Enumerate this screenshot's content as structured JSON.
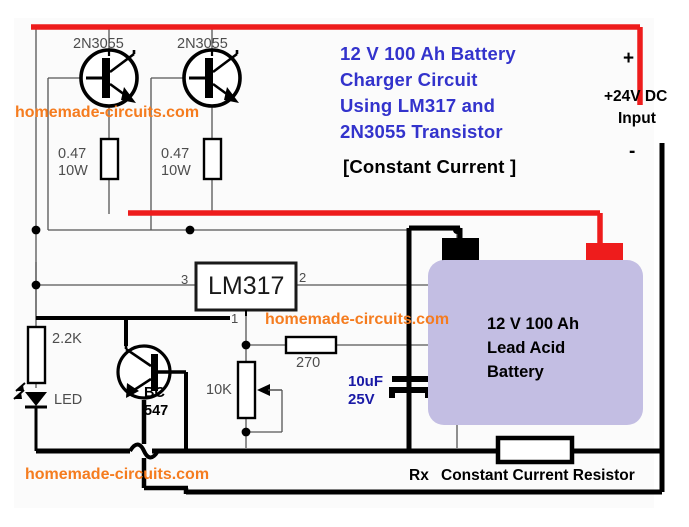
{
  "diagram": {
    "title_lines": [
      "12 V 100 Ah Battery",
      "Charger Circuit",
      "Using LM317 and",
      "2N3055  Transistor"
    ],
    "subtitle": "[Constant Current ]",
    "colors": {
      "title": "#3333cc",
      "subtitle": "#000000",
      "positive_rail": "#ee1c1c",
      "negative_rail": "#000000",
      "battery_body": "#c3bee3",
      "watermark": "#f57c1f",
      "thin_wire": "#555555"
    }
  },
  "supply": {
    "plus_sign": "+",
    "minus_sign": "-",
    "label_line1": "+24V DC",
    "label_line2": "Input"
  },
  "components": {
    "q1": {
      "name": "2N3055"
    },
    "q2": {
      "name": "2N3055"
    },
    "r_emitter1": {
      "value": "0.47",
      "rating": "10W"
    },
    "r_emitter2": {
      "value": "0.47",
      "rating": "10W"
    },
    "ic": {
      "name": "LM317",
      "pin_in": "3",
      "pin_out": "2",
      "pin_adj": "1"
    },
    "r_led": {
      "value": "2.2K"
    },
    "led": {
      "label": "LED"
    },
    "q3": {
      "name_line1": "BC",
      "name_line2": "547"
    },
    "pot": {
      "value": "10K"
    },
    "r_adj": {
      "value": "270"
    },
    "cap": {
      "value_line1": "10uF",
      "value_line2": "25V"
    },
    "rx": {
      "designator": "Rx",
      "description": "Constant Current Resistor"
    }
  },
  "battery": {
    "line1": "12 V 100 Ah",
    "line2": "Lead Acid",
    "line3": "Battery",
    "positive_terminal": "+",
    "negative_terminal": "-"
  },
  "watermarks": {
    "top": "homemade-circuits.com",
    "middle": "homemade-circuits.com",
    "bottom": "homemade-circuits.com"
  }
}
